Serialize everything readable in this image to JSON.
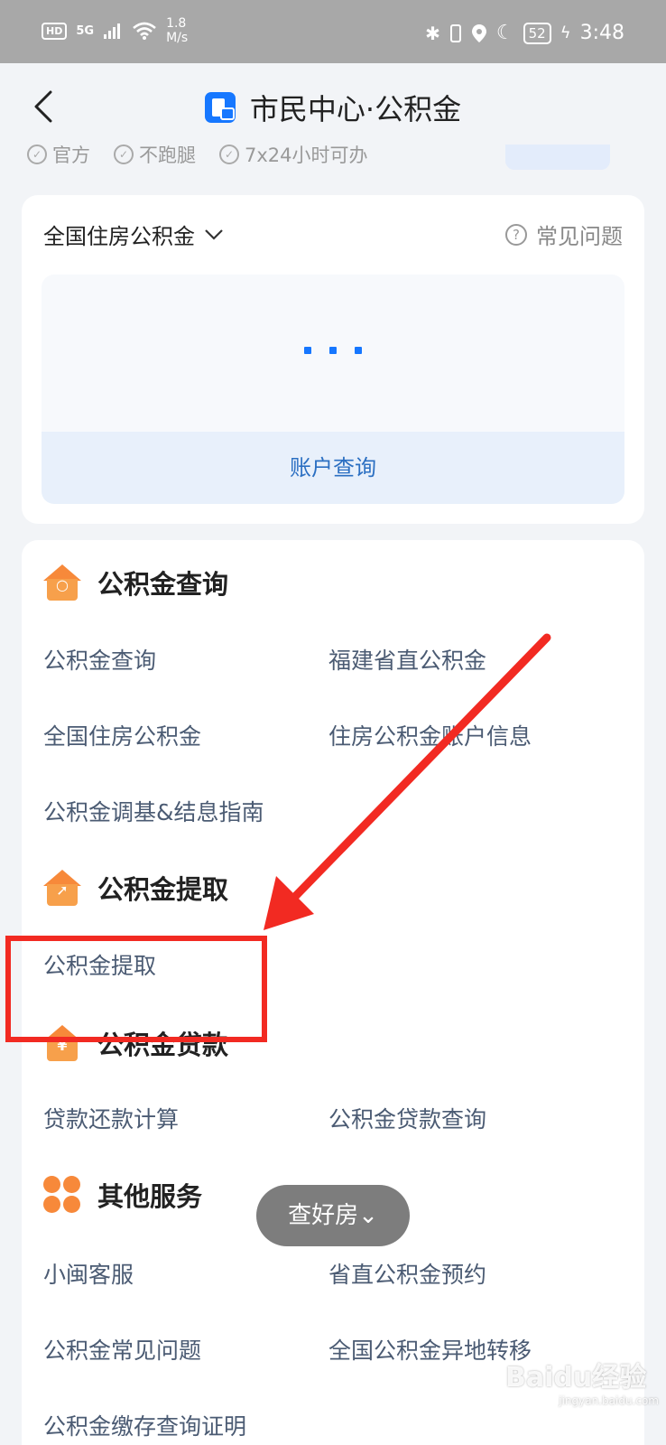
{
  "status_bar": {
    "hd": "HD",
    "signal": "5G",
    "net_speed_value": "1.8",
    "net_speed_unit": "M/s",
    "battery": "52",
    "time": "3:48"
  },
  "header": {
    "title": "市民中心·公积金"
  },
  "tags": [
    {
      "label": "官方"
    },
    {
      "label": "不跑腿"
    },
    {
      "label": "7x24小时可办"
    }
  ],
  "account": {
    "selector_label": "全国住房公积金",
    "faq_label": "常见问题",
    "query_label": "账户查询"
  },
  "sections": {
    "query": {
      "title": "公积金查询",
      "items": [
        "公积金查询",
        "福建省直公积金",
        "全国住房公积金",
        "住房公积金账户信息",
        "公积金调基&结息指南"
      ]
    },
    "withdraw": {
      "title": "公积金提取",
      "items": [
        "公积金提取"
      ]
    },
    "loan": {
      "title": "公积金贷款",
      "items": [
        "贷款还款计算",
        "公积金贷款查询"
      ]
    },
    "other": {
      "title": "其他服务",
      "items": [
        "小闽客服",
        "省直公积金预约",
        "公积金常见问题",
        "全国公积金异地转移",
        "公积金缴存查询证明"
      ]
    }
  },
  "fab": {
    "label": "查好房⌄"
  },
  "watermark": {
    "text": "Baidu经验",
    "subtext": "jingyan.baidu.com"
  },
  "colors": {
    "brand_blue": "#1677ff",
    "accent_orange": "#f7893a",
    "annotation_red": "#f22a22"
  }
}
